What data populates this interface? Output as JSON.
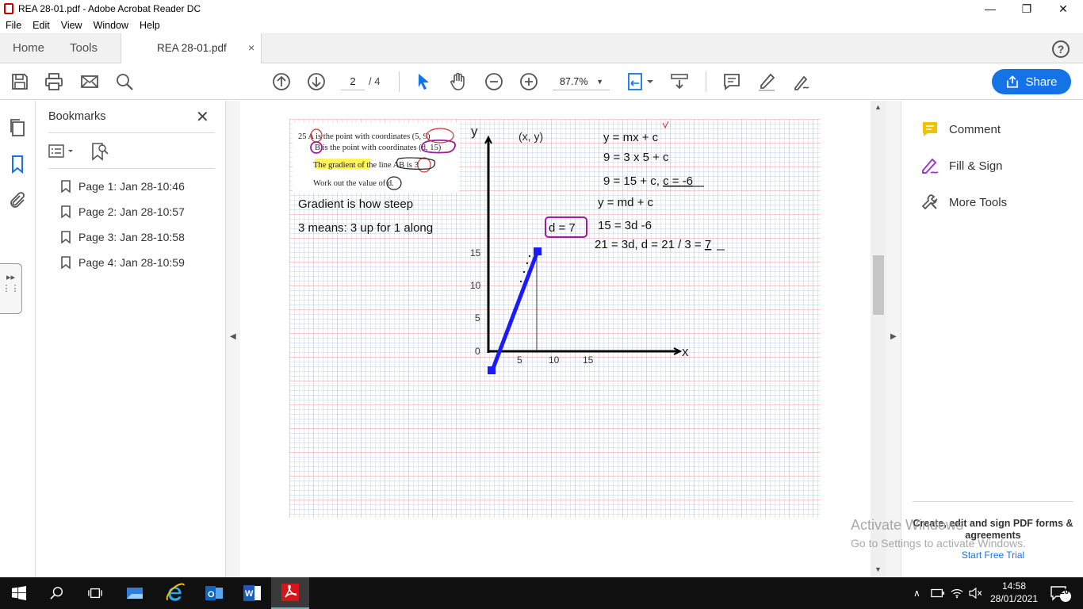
{
  "window": {
    "title": "REA 28-01.pdf - Adobe Acrobat Reader DC"
  },
  "menu": [
    "File",
    "Edit",
    "View",
    "Window",
    "Help"
  ],
  "tabs": {
    "home": "Home",
    "tools": "Tools",
    "document": "REA 28-01.pdf",
    "close": "×"
  },
  "toolbar": {
    "page_current": "2",
    "page_total": "/ 4",
    "zoom": "87.7%",
    "share": "Share"
  },
  "bookmarks": {
    "title": "Bookmarks",
    "items": [
      "Page 1: Jan 28-10:46",
      "Page 2: Jan 28-10:57",
      "Page 3: Jan 28-10:58",
      "Page 4: Jan 28-10:59"
    ]
  },
  "right_pane": {
    "comment": "Comment",
    "fill_sign": "Fill & Sign",
    "more_tools": "More Tools",
    "promo": "Create, edit and sign PDF forms & agreements",
    "trial": "Start Free Trial"
  },
  "watermark": {
    "line1": "Activate Windows",
    "line2": "Go to Settings to activate Windows."
  },
  "document": {
    "question": {
      "line1": "25  A is the point with coordinates (5, 9)",
      "line2": "B is the point with coordinates (d, 15)",
      "line3_pre": "T",
      "line3_highlight": "he gradient of",
      "line3_post": " the line AB is 3",
      "line4": "Work out the value of d."
    },
    "notes": {
      "gradient": "Gradient is how steep",
      "means": "3 means: 3 up for 1 along",
      "answer_box": "d = 7"
    },
    "working": {
      "eq1": "y = mx + c",
      "eq2": "9 = 3 x 5 + c",
      "eq3_pre": "9 = 15 + c, ",
      "eq3_ul": "c = -6",
      "eq4": "y = md + c",
      "eq5": "15 = 3d -6",
      "eq6_pre": "21 = 3d, d = 21 / 3 = ",
      "eq6_ul": "7"
    },
    "graph": {
      "y_axis": "y",
      "x_axis": "x",
      "point": "(x, y)",
      "y_ticks": [
        "15",
        "10",
        "5",
        "0"
      ],
      "x_ticks": [
        "5",
        "10",
        "15"
      ]
    }
  },
  "taskbar": {
    "time": "14:58",
    "date": "28/01/2021",
    "notifications": "20"
  },
  "colors": {
    "accent": "#1473e6",
    "pen_blue": "#1a1aff",
    "pen_purple": "#9b1d9b",
    "grid_blue": "#a8c4e8",
    "grid_red": "#e29a9a"
  }
}
